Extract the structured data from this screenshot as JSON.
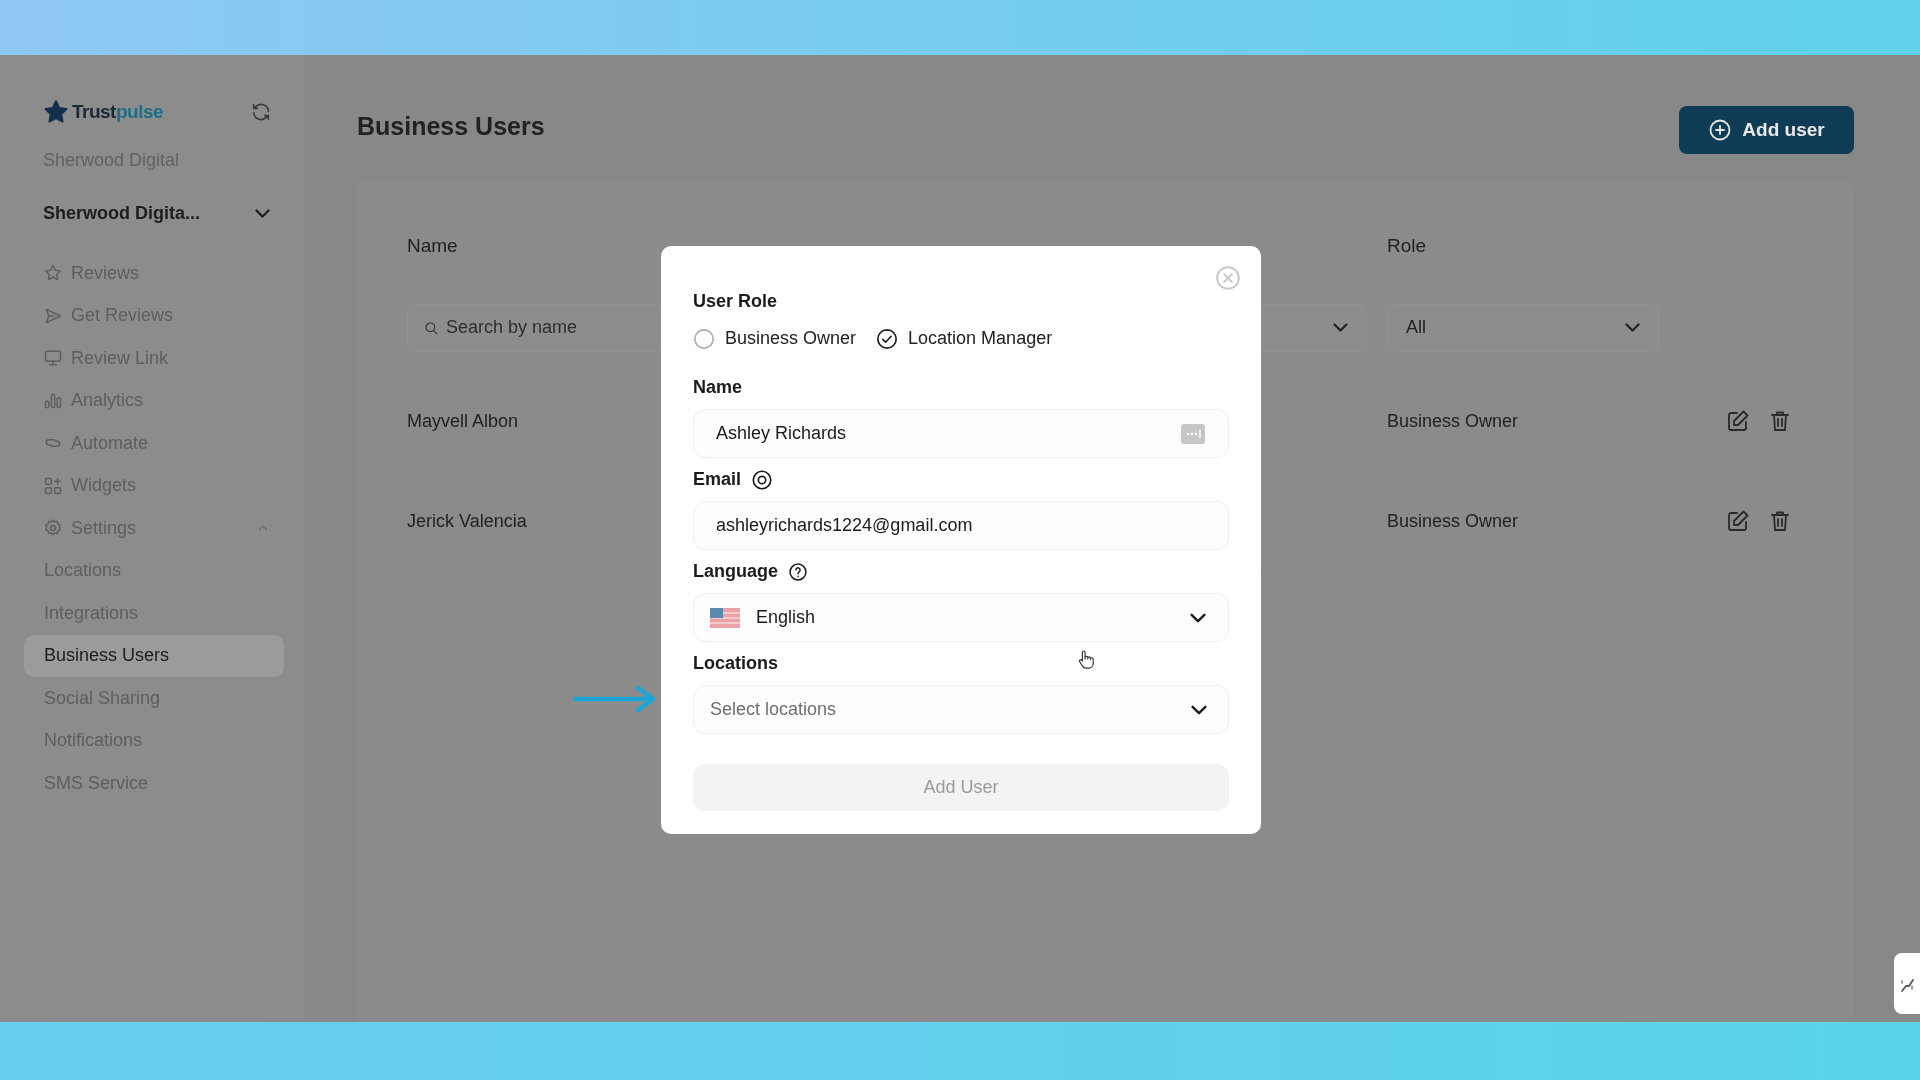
{
  "sidebar": {
    "logo": [
      "Trust",
      "pulse"
    ],
    "account_name": "Sherwood Digital",
    "account_select": "Sherwood Digita...",
    "items": [
      {
        "label": "Reviews",
        "selected": false
      },
      {
        "label": "Get Reviews",
        "selected": false
      },
      {
        "label": "Review Link",
        "selected": false
      },
      {
        "label": "Analytics",
        "selected": false
      },
      {
        "label": "Automate",
        "selected": false
      },
      {
        "label": "Widgets",
        "selected": false
      },
      {
        "label": "Settings",
        "selected": false,
        "expanded": true,
        "children": [
          {
            "label": "Locations",
            "selected": false
          },
          {
            "label": "Integrations",
            "selected": false
          },
          {
            "label": "Business Users",
            "selected": true
          },
          {
            "label": "Social Sharing",
            "selected": false
          },
          {
            "label": "Notifications",
            "selected": false
          },
          {
            "label": "SMS Service",
            "selected": false
          }
        ]
      }
    ]
  },
  "main": {
    "title": "Business Users",
    "add_button": "Add user",
    "table": {
      "columns": [
        {
          "label": "Name"
        },
        {
          "label": "Role"
        }
      ],
      "filters": {
        "search_placeholder": "Search by name",
        "role": "All"
      },
      "rows": [
        {
          "name": "Mayvell Albon",
          "role": "Business Owner"
        },
        {
          "name": "Jerick Valencia",
          "role": "Business Owner"
        }
      ]
    }
  },
  "modal": {
    "role_label": "User Role",
    "roles": [
      {
        "label": "Business Owner",
        "selected": false
      },
      {
        "label": "Location Manager",
        "selected": true
      }
    ],
    "name": {
      "label": "Name",
      "value": "Ashley Richards"
    },
    "email": {
      "label": "Email",
      "value": "ashleyrichards1224@gmail.com"
    },
    "language": {
      "label": "Language",
      "value": "English"
    },
    "locations": {
      "label": "Locations",
      "placeholder": "Select locations"
    },
    "submit": {
      "label": "Add User",
      "disabled": true
    }
  }
}
